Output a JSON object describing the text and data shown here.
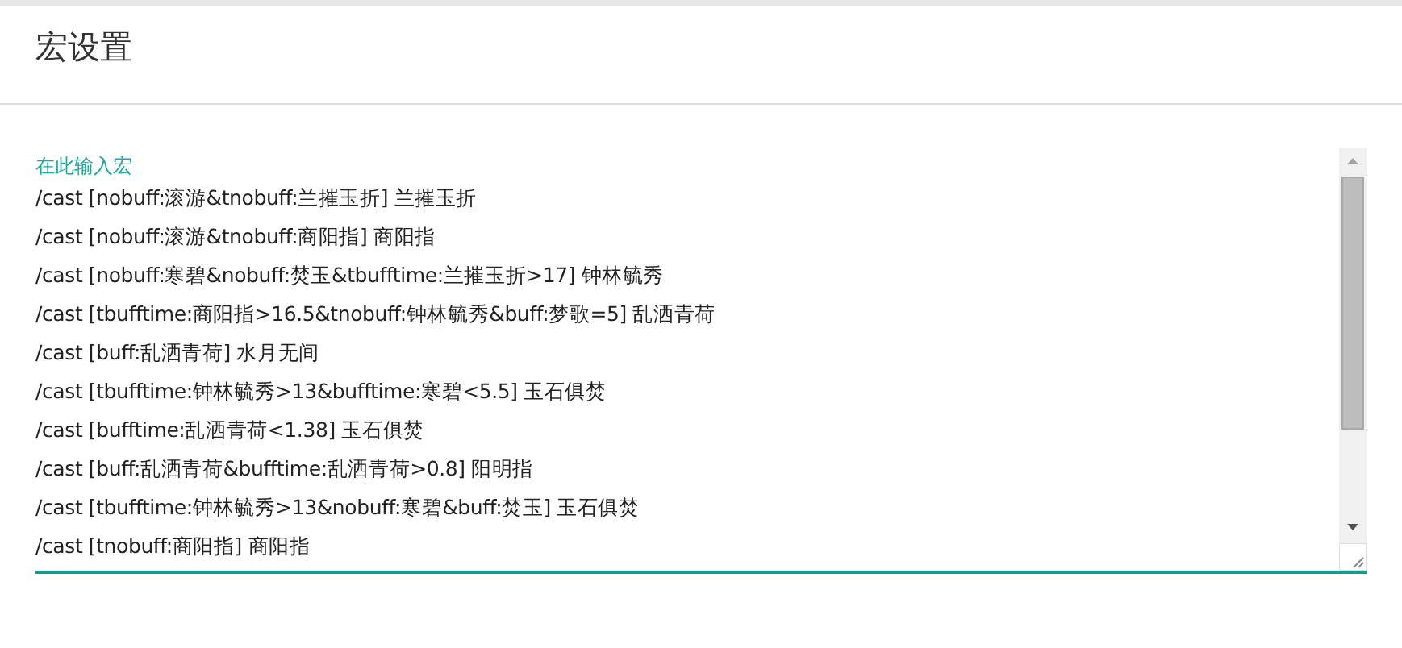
{
  "page": {
    "title": "宏设置"
  },
  "macro_field": {
    "label": "在此输入宏",
    "lines": [
      "/cast [nobuff:滚游&tnobuff:兰摧玉折] 兰摧玉折",
      "/cast [nobuff:滚游&tnobuff:商阳指] 商阳指",
      "/cast [nobuff:寒碧&nobuff:焚玉&tbufftime:兰摧玉折>17] 钟林毓秀",
      "/cast [tbufftime:商阳指>16.5&tnobuff:钟林毓秀&buff:梦歌=5] 乱洒青荷",
      "/cast [buff:乱洒青荷] 水月无间",
      "/cast [tbufftime:钟林毓秀>13&bufftime:寒碧<5.5] 玉石俱焚",
      "/cast [bufftime:乱洒青荷<1.38] 玉石俱焚",
      "/cast [buff:乱洒青荷&bufftime:乱洒青荷>0.8] 阳明指",
      "/cast [tbufftime:钟林毓秀>13&nobuff:寒碧&buff:焚玉] 玉石俱焚",
      "/cast [tnobuff:商阳指] 商阳指"
    ]
  }
}
